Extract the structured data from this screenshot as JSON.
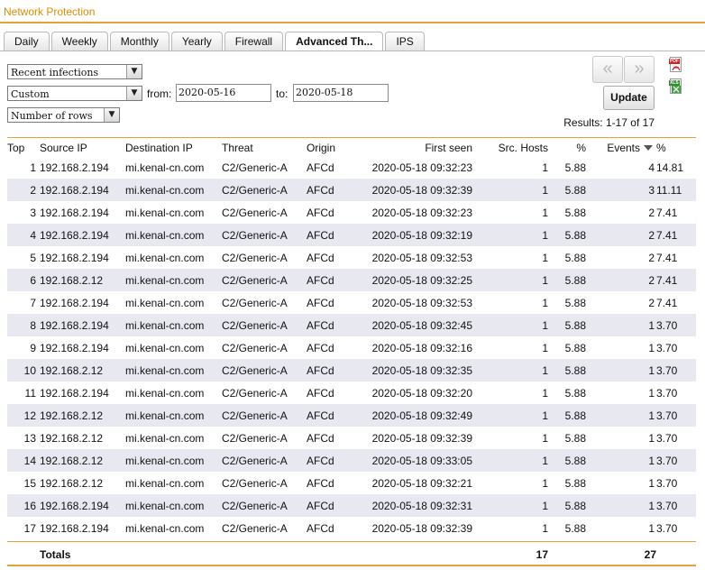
{
  "app": {
    "title": "Network Protection"
  },
  "tabs": [
    "Daily",
    "Weekly",
    "Monthly",
    "Yearly",
    "Firewall",
    "Advanced Th...",
    "IPS"
  ],
  "filters": {
    "report": "Recent infections",
    "range": "Custom",
    "from_label": "from:",
    "from_value": "2020-05-16",
    "to_label": "to:",
    "to_value": "2020-05-18",
    "rows": "Number of rows"
  },
  "pager": {
    "prev": "«",
    "next": "»"
  },
  "update_label": "Update",
  "results": "Results: 1-17 of 17",
  "exports": {
    "pdf": "PDF",
    "xls": "XLS"
  },
  "colors": {
    "accent": "#e8a03a",
    "title": "#e08a00",
    "row_alt": "#e8e8f0"
  },
  "table": {
    "headers": [
      "Top",
      "Source IP",
      "Destination IP",
      "Threat",
      "Origin",
      "First seen",
      "Src. Hosts",
      "%",
      "Events",
      "%"
    ],
    "rows": [
      [
        "1",
        "192.168.2.194",
        "mi.kenal-cn.com",
        "C2/Generic-A",
        "AFCd",
        "2020-05-18 09:32:23",
        "1",
        "5.88",
        "4",
        "14.81"
      ],
      [
        "2",
        "192.168.2.194",
        "mi.kenal-cn.com",
        "C2/Generic-A",
        "AFCd",
        "2020-05-18 09:32:39",
        "1",
        "5.88",
        "3",
        "11.11"
      ],
      [
        "3",
        "192.168.2.194",
        "mi.kenal-cn.com",
        "C2/Generic-A",
        "AFCd",
        "2020-05-18 09:32:23",
        "1",
        "5.88",
        "2",
        "7.41"
      ],
      [
        "4",
        "192.168.2.194",
        "mi.kenal-cn.com",
        "C2/Generic-A",
        "AFCd",
        "2020-05-18 09:32:19",
        "1",
        "5.88",
        "2",
        "7.41"
      ],
      [
        "5",
        "192.168.2.194",
        "mi.kenal-cn.com",
        "C2/Generic-A",
        "AFCd",
        "2020-05-18 09:32:53",
        "1",
        "5.88",
        "2",
        "7.41"
      ],
      [
        "6",
        "192.168.2.12",
        "mi.kenal-cn.com",
        "C2/Generic-A",
        "AFCd",
        "2020-05-18 09:32:25",
        "1",
        "5.88",
        "2",
        "7.41"
      ],
      [
        "7",
        "192.168.2.194",
        "mi.kenal-cn.com",
        "C2/Generic-A",
        "AFCd",
        "2020-05-18 09:32:53",
        "1",
        "5.88",
        "2",
        "7.41"
      ],
      [
        "8",
        "192.168.2.194",
        "mi.kenal-cn.com",
        "C2/Generic-A",
        "AFCd",
        "2020-05-18 09:32:45",
        "1",
        "5.88",
        "1",
        "3.70"
      ],
      [
        "9",
        "192.168.2.194",
        "mi.kenal-cn.com",
        "C2/Generic-A",
        "AFCd",
        "2020-05-18 09:32:16",
        "1",
        "5.88",
        "1",
        "3.70"
      ],
      [
        "10",
        "192.168.2.12",
        "mi.kenal-cn.com",
        "C2/Generic-A",
        "AFCd",
        "2020-05-18 09:32:35",
        "1",
        "5.88",
        "1",
        "3.70"
      ],
      [
        "11",
        "192.168.2.194",
        "mi.kenal-cn.com",
        "C2/Generic-A",
        "AFCd",
        "2020-05-18 09:32:20",
        "1",
        "5.88",
        "1",
        "3.70"
      ],
      [
        "12",
        "192.168.2.12",
        "mi.kenal-cn.com",
        "C2/Generic-A",
        "AFCd",
        "2020-05-18 09:32:49",
        "1",
        "5.88",
        "1",
        "3.70"
      ],
      [
        "13",
        "192.168.2.12",
        "mi.kenal-cn.com",
        "C2/Generic-A",
        "AFCd",
        "2020-05-18 09:32:39",
        "1",
        "5.88",
        "1",
        "3.70"
      ],
      [
        "14",
        "192.168.2.12",
        "mi.kenal-cn.com",
        "C2/Generic-A",
        "AFCd",
        "2020-05-18 09:33:05",
        "1",
        "5.88",
        "1",
        "3.70"
      ],
      [
        "15",
        "192.168.2.12",
        "mi.kenal-cn.com",
        "C2/Generic-A",
        "AFCd",
        "2020-05-18 09:32:21",
        "1",
        "5.88",
        "1",
        "3.70"
      ],
      [
        "16",
        "192.168.2.194",
        "mi.kenal-cn.com",
        "C2/Generic-A",
        "AFCd",
        "2020-05-18 09:32:31",
        "1",
        "5.88",
        "1",
        "3.70"
      ],
      [
        "17",
        "192.168.2.194",
        "mi.kenal-cn.com",
        "C2/Generic-A",
        "AFCd",
        "2020-05-18 09:32:39",
        "1",
        "5.88",
        "1",
        "3.70"
      ]
    ],
    "totals": {
      "label": "Totals",
      "src_hosts": "17",
      "events": "27"
    }
  }
}
